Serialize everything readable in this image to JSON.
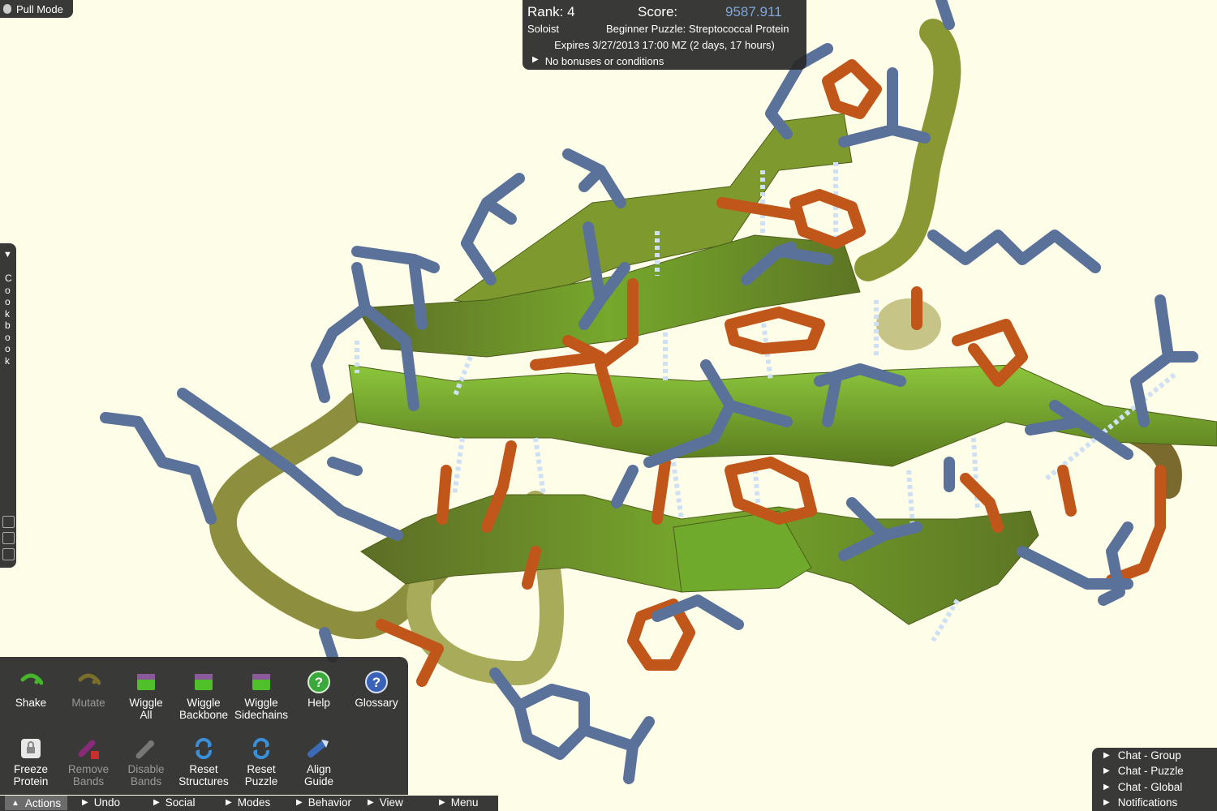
{
  "pull_mode": {
    "label": "Pull Mode"
  },
  "score_panel": {
    "rank": "Rank: 4",
    "score_label": "Score:",
    "score_value": "9587.911",
    "team": "Soloist",
    "puzzle_name": "Beginner Puzzle: Streptococcal Protein",
    "expires": "Expires 3/27/2013 17:00 MZ (2 days, 17 hours)",
    "bonuses": "No bonuses or conditions"
  },
  "cookbook": {
    "label": "Cookbook"
  },
  "actions": [
    {
      "label": "Shake",
      "icon": "shake-icon",
      "enabled": true
    },
    {
      "label": "Mutate",
      "icon": "mutate-icon",
      "enabled": false
    },
    {
      "label": "Wiggle All",
      "icon": "wiggle-all-icon",
      "enabled": true
    },
    {
      "label": "Wiggle Backbone",
      "icon": "wiggle-backbone-icon",
      "enabled": true
    },
    {
      "label": "Wiggle Sidechains",
      "icon": "wiggle-sidechains-icon",
      "enabled": true
    },
    {
      "label": "Help",
      "icon": "help-icon",
      "enabled": true
    },
    {
      "label": "Glossary",
      "icon": "glossary-icon",
      "enabled": true
    },
    {
      "label": "Freeze Protein",
      "icon": "lock-icon",
      "enabled": true
    },
    {
      "label": "Remove Bands",
      "icon": "remove-bands-icon",
      "enabled": false
    },
    {
      "label": "Disable Bands",
      "icon": "disable-bands-icon",
      "enabled": false
    },
    {
      "label": "Reset Structures",
      "icon": "reset-structures-icon",
      "enabled": true
    },
    {
      "label": "Reset Puzzle",
      "icon": "reset-puzzle-icon",
      "enabled": true
    },
    {
      "label": "Align Guide",
      "icon": "align-guide-icon",
      "enabled": true
    }
  ],
  "bottom_menu": [
    {
      "label": "Actions",
      "arrow": "▲"
    },
    {
      "label": "Undo",
      "arrow": "▶"
    },
    {
      "label": "Social",
      "arrow": "▶"
    },
    {
      "label": "Modes",
      "arrow": "▶"
    },
    {
      "label": "Behavior",
      "arrow": "▶"
    },
    {
      "label": "View",
      "arrow": "▶"
    },
    {
      "label": "Menu",
      "arrow": "▶"
    }
  ],
  "chat": [
    {
      "label": "Chat - Group"
    },
    {
      "label": "Chat - Puzzle"
    },
    {
      "label": "Chat - Global"
    },
    {
      "label": "Notifications"
    }
  ],
  "colors": {
    "background": "#fdfde8",
    "sheet": "#7fb02c",
    "sheet_dark": "#5f7a22",
    "loop": "#8e9a3c",
    "sidechain_blue": "#5a7199",
    "sidechain_orange": "#c0561a",
    "hbond": "#cfe0f5",
    "score": "#7fa6d6"
  }
}
